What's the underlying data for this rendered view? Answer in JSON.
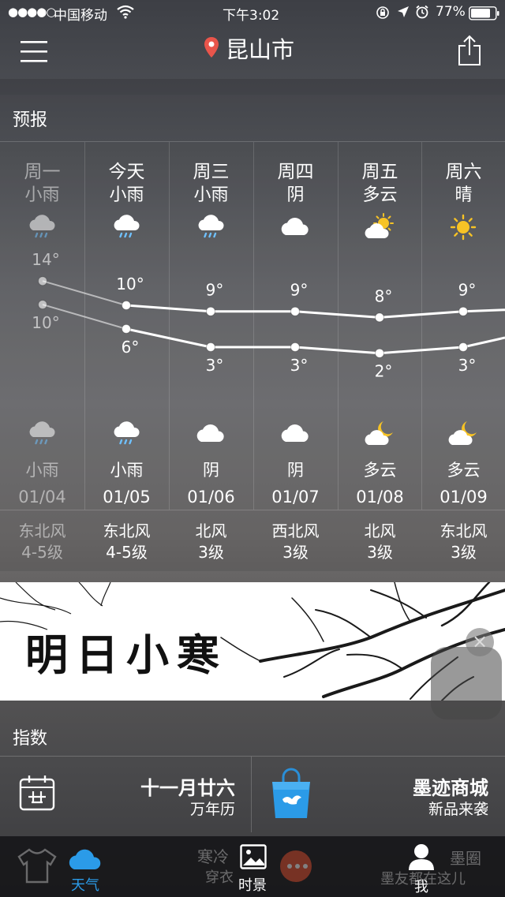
{
  "status_bar": {
    "signal": "●●●●○",
    "carrier": "中国移动",
    "time": "下午3:02",
    "battery": "77%"
  },
  "header": {
    "city": "昆山市"
  },
  "forecast": {
    "title": "预报",
    "days": [
      {
        "day": "周一",
        "cond_day": "小雨",
        "icon_day": "rain-cloud-icon",
        "high": "14°",
        "low": "10°",
        "icon_night": "rain-cloud-icon",
        "cond_night": "小雨",
        "date": "01/04",
        "wind_dir": "东北风",
        "wind_level": "4-5级"
      },
      {
        "day": "今天",
        "cond_day": "小雨",
        "icon_day": "rain-cloud-icon",
        "high": "10°",
        "low": "6°",
        "icon_night": "rain-cloud-icon",
        "cond_night": "小雨",
        "date": "01/05",
        "wind_dir": "东北风",
        "wind_level": "4-5级"
      },
      {
        "day": "周三",
        "cond_day": "小雨",
        "icon_day": "rain-cloud-icon",
        "high": "9°",
        "low": "3°",
        "icon_night": "cloud-icon",
        "cond_night": "阴",
        "date": "01/06",
        "wind_dir": "北风",
        "wind_level": "3级"
      },
      {
        "day": "周四",
        "cond_day": "阴",
        "icon_day": "cloud-icon",
        "high": "9°",
        "low": "3°",
        "icon_night": "cloud-icon",
        "cond_night": "阴",
        "date": "01/07",
        "wind_dir": "西北风",
        "wind_level": "3级"
      },
      {
        "day": "周五",
        "cond_day": "多云",
        "icon_day": "sun-cloud-icon",
        "high": "8°",
        "low": "2°",
        "icon_night": "moon-cloud-icon",
        "cond_night": "多云",
        "date": "01/08",
        "wind_dir": "北风",
        "wind_level": "3级"
      },
      {
        "day": "周六",
        "cond_day": "晴",
        "icon_day": "sun-icon",
        "high": "9°",
        "low": "3°",
        "icon_night": "moon-cloud-icon",
        "cond_night": "多云",
        "date": "01/09",
        "wind_dir": "东北风",
        "wind_level": "3级"
      }
    ],
    "high_values": [
      14,
      10,
      9,
      9,
      8,
      9
    ],
    "low_values": [
      10,
      6,
      3,
      3,
      2,
      3
    ]
  },
  "banner": {
    "text": "明日小寒"
  },
  "index": {
    "title": "指数",
    "cards": [
      {
        "title": "十一月廿六",
        "subtitle": "万年历",
        "icon": "calendar-icon"
      },
      {
        "title": "墨迹商城",
        "subtitle": "新品来袭",
        "icon": "shopping-bag-icon"
      }
    ]
  },
  "tabbar": {
    "tabs": [
      {
        "label": "天气",
        "icon": "cloud-icon",
        "active": true
      },
      {
        "label": "时景",
        "icon": "picture-icon",
        "active": false
      },
      {
        "label": "我",
        "icon": "person-icon",
        "active": false
      }
    ],
    "overlay_text": {
      "left_title": "寒冷",
      "left_sub": "穿衣",
      "right_title": "墨圈",
      "right_sub": "墨友都在这儿"
    }
  },
  "colors": {
    "accent_blue": "#2b9be8",
    "location_red": "#e9554b",
    "sun_yellow": "#f7c325"
  }
}
